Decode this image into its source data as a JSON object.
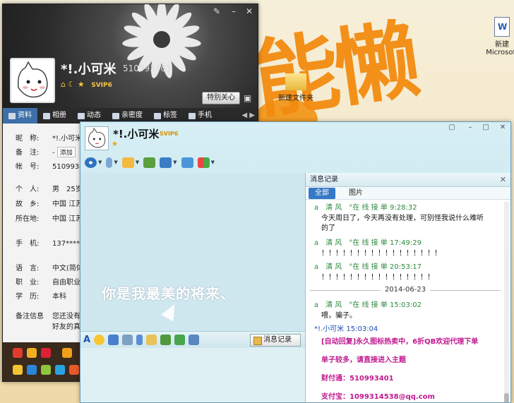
{
  "desktop": {
    "icon_word_label": "新建",
    "icon_word_sub": "Microsoft",
    "icon_folder_label": "新建文件夹",
    "brush_text": "能懒"
  },
  "profile": {
    "name": "*!.小可米",
    "qq_number": "510993401",
    "badge_svip": "SVIP6",
    "special_care_button": "特别关心",
    "tabs": [
      {
        "label": "资料"
      },
      {
        "label": "相册"
      },
      {
        "label": "动态"
      },
      {
        "label": "亲密度"
      },
      {
        "label": "标签"
      },
      {
        "label": "手机"
      }
    ],
    "fields": [
      {
        "key": "昵　称:",
        "value": "*!.小可米"
      },
      {
        "key": "备　注:",
        "value": "-"
      },
      {
        "key": "帐　号:",
        "value": "51099340"
      },
      {
        "key": "个　人:",
        "value": "男　25岁"
      },
      {
        "key": "故　乡:",
        "value": "中国 江苏"
      },
      {
        "key": "所在地:",
        "value": "中国 江苏"
      },
      {
        "key": "手　机:",
        "value": "137******"
      },
      {
        "key": "语　言:",
        "value": "中文(简体"
      },
      {
        "key": "职　业:",
        "value": "自由职业"
      },
      {
        "key": "学　历:",
        "value": "本科"
      },
      {
        "key": "备注信息",
        "value": "您还没有"
      }
    ],
    "remark_add_label": "添加",
    "remark_tail": "好友的真"
  },
  "chat": {
    "name": "*!.小可米",
    "badge_svip": "SVIP6",
    "slogan": "你是我最美的将来、",
    "message_record_button": "消息记录",
    "colors": {
      "accent": "#3679c6",
      "green_sender": "#2b8a3e",
      "auto_reply": "#c0188f"
    }
  },
  "history": {
    "title": "消息记录",
    "tabs": [
      {
        "label": "全部"
      },
      {
        "label": "图片"
      }
    ],
    "entries": [
      {
        "head": "a　清 风　°在 线 接 单 9:28:32",
        "text": "今天周日了，今天再没有处理，可别怪我说什么难听"
      },
      {
        "text": "的了"
      },
      {
        "head": "a　清 风　°在 线 接 单 17:49:29",
        "text": "！！！！！！！！！！！！！！！！！"
      },
      {
        "head": "a　清 风　°在 线 接 单 20:53:17",
        "text": "！！！！！！！！！！！！！！！！"
      },
      {
        "date": "2014-06-23"
      },
      {
        "head": "a　清 风　°在 线 接 单 15:03:02",
        "text": "喂，骗子。"
      },
      {
        "head": "*!.小可米 15:03:04"
      },
      {
        "auto": "[自动回复]永久图标热卖中，6折QB欢迎代理下单"
      },
      {
        "auto": "单子较多，请直接进入主题"
      },
      {
        "auto": "财付通：510993401"
      },
      {
        "auto": "支付宝：1099314538@qq.com"
      }
    ]
  }
}
